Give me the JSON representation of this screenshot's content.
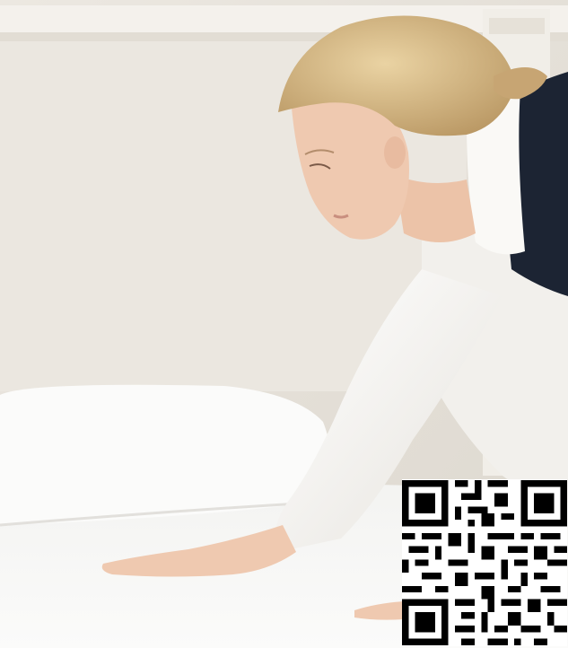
{
  "image": {
    "subject": "housekeeper-making-bed",
    "colors": {
      "wall": "#e8e4dc",
      "headboard": "#f1eee8",
      "sheet": "#f7f7f5",
      "pillow": "#fbfbfa",
      "shirt": "#f4f2ee",
      "vest": "#1c2433",
      "hair": "#d8bd8a",
      "skin": "#efc9b0"
    }
  },
  "qr_code": {
    "icon": "qr-code-icon"
  }
}
